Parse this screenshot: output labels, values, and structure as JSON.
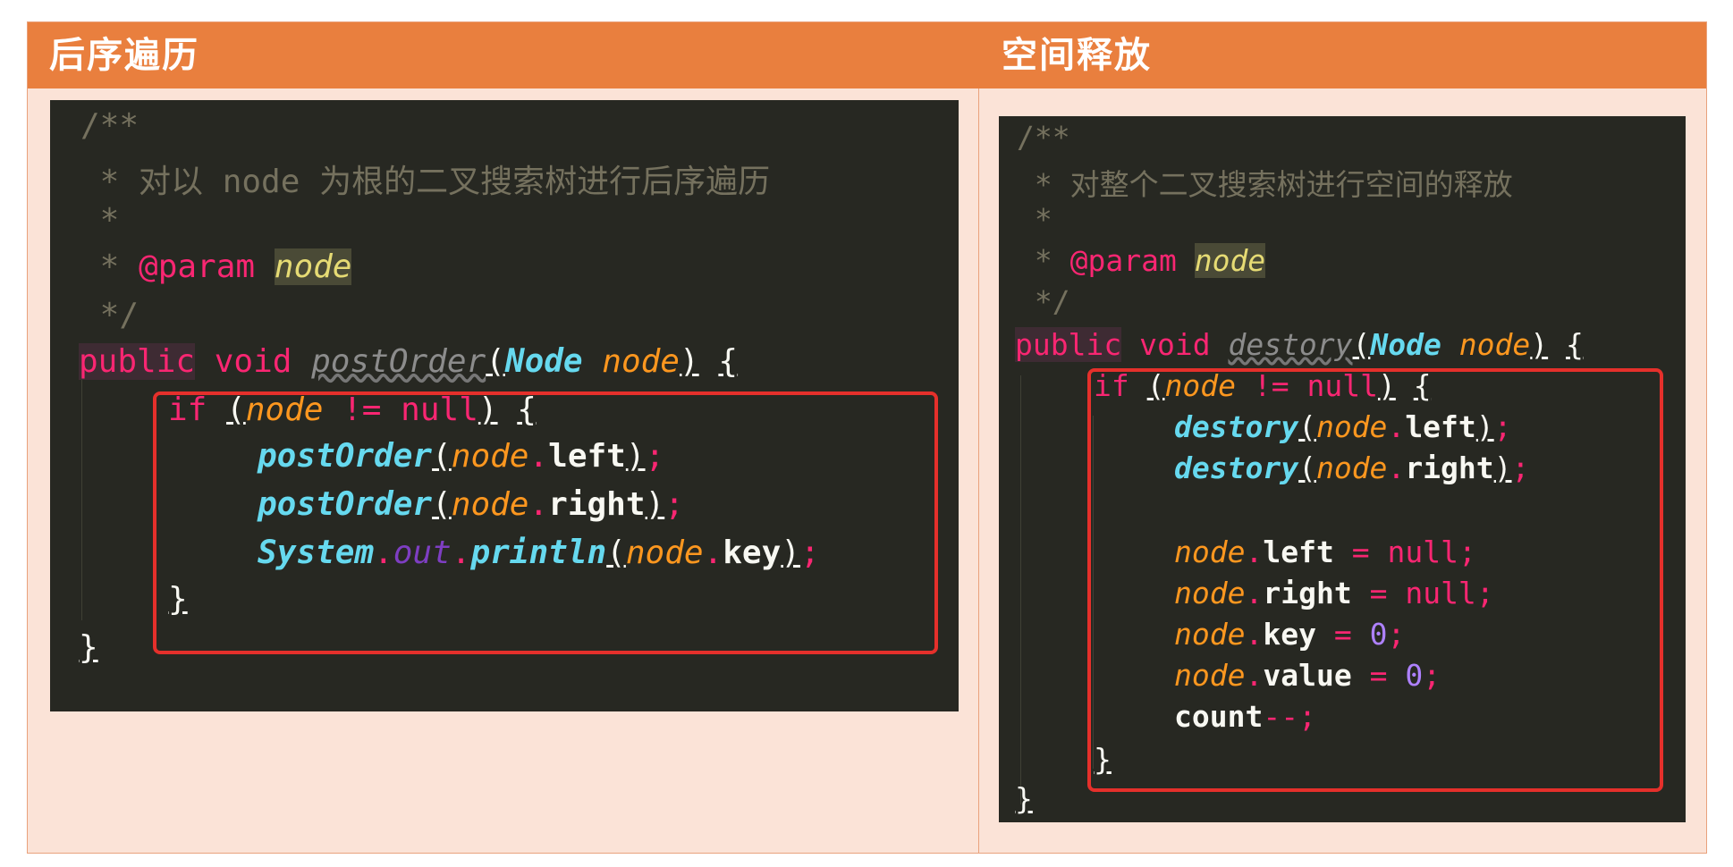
{
  "headers": {
    "left": "后序遍历",
    "right": "空间释放"
  },
  "left_code": {
    "c1": "/**",
    "c2_star": " * ",
    "c2_text": "对以 node 为根的二叉搜索树进行后序遍历",
    "c3": " *",
    "c4_star": " * ",
    "c4_ann": "@param",
    "c4_param": "node",
    "c5": " */",
    "sig_public": "public",
    "sig_void": "void",
    "sig_name": "postOrder",
    "sig_type": "Node",
    "sig_param": "node",
    "if_kw": "if",
    "if_var": "node",
    "if_op": "!=",
    "if_null": "null",
    "call1_fn": "postOrder",
    "call1_var": "node",
    "call1_field": "left",
    "call2_fn": "postOrder",
    "call2_var": "node",
    "call2_field": "right",
    "sys_cls": "System",
    "sys_out": "out",
    "sys_fn": "println",
    "sys_var": "node",
    "sys_field": "key",
    "close_inner": "}",
    "close_outer": "}"
  },
  "right_code": {
    "c1": "/**",
    "c2_star": " * ",
    "c2_text": "对整个二叉搜索树进行空间的释放",
    "c3": " *",
    "c4_star": " * ",
    "c4_ann": "@param",
    "c4_param": "node",
    "c5": " */",
    "sig_public": "public",
    "sig_void": "void",
    "sig_name": "destory",
    "sig_type": "Node",
    "sig_param": "node",
    "if_kw": "if",
    "if_var": "node",
    "if_op": "!=",
    "if_null": "null",
    "call1_fn": "destory",
    "call1_var": "node",
    "call1_field": "left",
    "call2_fn": "destory",
    "call2_var": "node",
    "call2_field": "right",
    "a1_var": "node",
    "a1_field": "left",
    "a1_val": "null",
    "a2_var": "node",
    "a2_field": "right",
    "a2_val": "null",
    "a3_var": "node",
    "a3_field": "key",
    "a3_val": "0",
    "a4_var": "node",
    "a4_field": "value",
    "a4_val": "0",
    "count_var": "count",
    "count_op": "--",
    "close_inner": "}",
    "close_outer": "}"
  },
  "colors": {
    "header_bg": "#e97f3e",
    "table_bg": "#fbe3d7",
    "editor_bg": "#272822",
    "highlight_border": "#e5302b"
  }
}
